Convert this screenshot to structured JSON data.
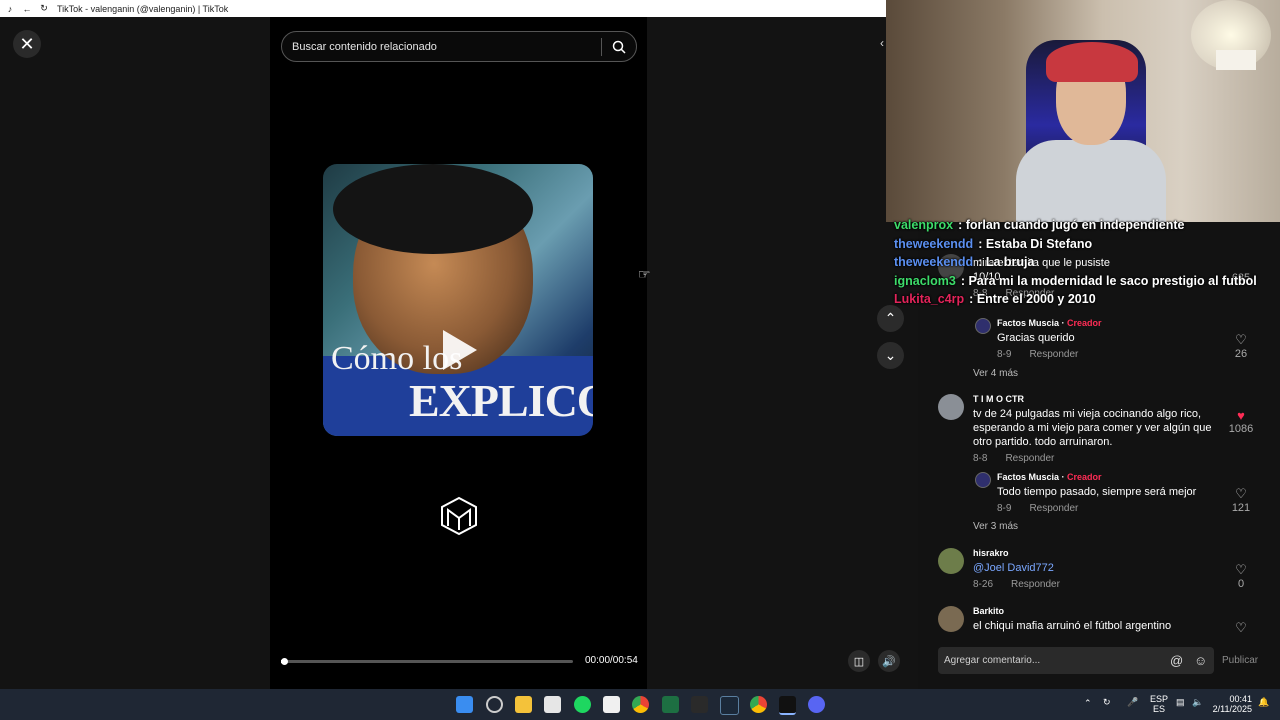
{
  "browser": {
    "title": "TikTok - valenganin (@valenganin) | TikTok"
  },
  "search": {
    "placeholder": "Buscar contenido relacionado"
  },
  "video": {
    "caption_line1": "Cómo los",
    "caption_line2": "EXPLICO?",
    "time": "00:00/00:54",
    "progress": 0.01
  },
  "chat": [
    {
      "user": "valenprox",
      "color": "#3ddc6a",
      "text": "forlan cuando jugó en independiente"
    },
    {
      "user": "theweekendd",
      "color": "#5b8ff0",
      "text": "Estaba Di Stefano"
    },
    {
      "user": "theweekendd",
      "color": "#5b8ff0",
      "text": "La bruja"
    },
    {
      "user": "ignaclom3",
      "color": "#3ddc6a",
      "text": "Para mi la modernidad le saco prestigio al futbol"
    },
    {
      "user": "Lukita_c4rp",
      "color": "#e3245a",
      "text": "Entre el 2000 y 2010"
    }
  ],
  "comments": {
    "top_partial": {
      "text": "mira el temita que le pusiste",
      "rating": "10/10",
      "date": "8-8",
      "reply": "Responder",
      "likes": "635"
    },
    "reply1": {
      "name": "Factos Muscia",
      "badge": "Creador",
      "text": "Gracias querido",
      "date": "8-9",
      "reply": "Responder",
      "likes": "26"
    },
    "more1": "Ver 4 más",
    "c2": {
      "name": "T I M O CTR",
      "text": "tv de 24 pulgadas mi vieja cocinando algo rico, esperando a mi viejo para comer y ver algún que otro partido. todo arruinaron.",
      "date": "8-8",
      "reply": "Responder",
      "likes": "1086"
    },
    "reply2": {
      "name": "Factos Muscia",
      "badge": "Creador",
      "text": "Todo tiempo pasado, siempre será mejor",
      "date": "8-9",
      "reply": "Responder",
      "likes": "121"
    },
    "more2": "Ver 3 más",
    "c3": {
      "name": "hisrakro",
      "text": "@Joel David772",
      "date": "8-26",
      "reply": "Responder",
      "likes": "0"
    },
    "c4": {
      "name": "Barkito",
      "text": "el chiqui mafia arruinó el fútbol argentino"
    }
  },
  "comment_input": {
    "placeholder": "Agregar comentario...",
    "publish": "Publicar"
  },
  "taskbar": {
    "lang1": "ESP",
    "lang2": "ES",
    "time": "00:41",
    "date": "2/11/2025"
  }
}
